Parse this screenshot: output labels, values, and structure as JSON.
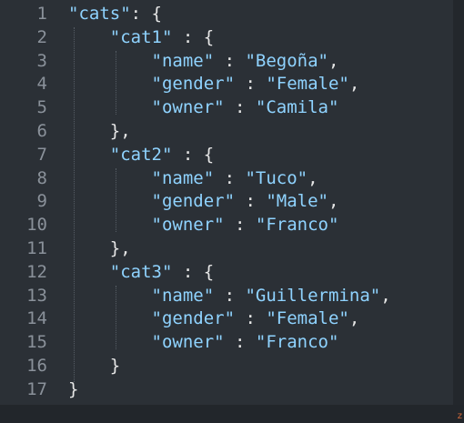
{
  "colors": {
    "background": "#2b3036",
    "line_number": "#8a919a",
    "string": "#8fd3ff",
    "punctuation": "#e6e6e6"
  },
  "lines": [
    {
      "num": "1",
      "indent": "",
      "tokens": [
        {
          "t": "s",
          "v": "\"cats\""
        },
        {
          "t": "p",
          "v": ": {"
        }
      ]
    },
    {
      "num": "2",
      "indent": "    ",
      "tokens": [
        {
          "t": "s",
          "v": "\"cat1\""
        },
        {
          "t": "p",
          "v": " : {"
        }
      ]
    },
    {
      "num": "3",
      "indent": "        ",
      "tokens": [
        {
          "t": "s",
          "v": "\"name\""
        },
        {
          "t": "p",
          "v": " : "
        },
        {
          "t": "v",
          "v": "\"Begoña\""
        },
        {
          "t": "p",
          "v": ","
        }
      ]
    },
    {
      "num": "4",
      "indent": "        ",
      "tokens": [
        {
          "t": "s",
          "v": "\"gender\""
        },
        {
          "t": "p",
          "v": " : "
        },
        {
          "t": "v",
          "v": "\"Female\""
        },
        {
          "t": "p",
          "v": ","
        }
      ]
    },
    {
      "num": "5",
      "indent": "        ",
      "tokens": [
        {
          "t": "s",
          "v": "\"owner\""
        },
        {
          "t": "p",
          "v": " : "
        },
        {
          "t": "v",
          "v": "\"Camila\""
        }
      ]
    },
    {
      "num": "6",
      "indent": "    ",
      "tokens": [
        {
          "t": "p",
          "v": "},"
        }
      ]
    },
    {
      "num": "7",
      "indent": "    ",
      "tokens": [
        {
          "t": "s",
          "v": "\"cat2\""
        },
        {
          "t": "p",
          "v": " : {"
        }
      ]
    },
    {
      "num": "8",
      "indent": "        ",
      "tokens": [
        {
          "t": "s",
          "v": "\"name\""
        },
        {
          "t": "p",
          "v": " : "
        },
        {
          "t": "v",
          "v": "\"Tuco\""
        },
        {
          "t": "p",
          "v": ","
        }
      ]
    },
    {
      "num": "9",
      "indent": "        ",
      "tokens": [
        {
          "t": "s",
          "v": "\"gender\""
        },
        {
          "t": "p",
          "v": " : "
        },
        {
          "t": "v",
          "v": "\"Male\""
        },
        {
          "t": "p",
          "v": ","
        }
      ]
    },
    {
      "num": "10",
      "indent": "        ",
      "tokens": [
        {
          "t": "s",
          "v": "\"owner\""
        },
        {
          "t": "p",
          "v": " : "
        },
        {
          "t": "v",
          "v": "\"Franco\""
        }
      ]
    },
    {
      "num": "11",
      "indent": "    ",
      "tokens": [
        {
          "t": "p",
          "v": "},"
        }
      ]
    },
    {
      "num": "12",
      "indent": "    ",
      "tokens": [
        {
          "t": "s",
          "v": "\"cat3\""
        },
        {
          "t": "p",
          "v": " : {"
        }
      ]
    },
    {
      "num": "13",
      "indent": "        ",
      "tokens": [
        {
          "t": "s",
          "v": "\"name\""
        },
        {
          "t": "p",
          "v": " : "
        },
        {
          "t": "v",
          "v": "\"Guillermina\""
        },
        {
          "t": "p",
          "v": ","
        }
      ]
    },
    {
      "num": "14",
      "indent": "        ",
      "tokens": [
        {
          "t": "s",
          "v": "\"gender\""
        },
        {
          "t": "p",
          "v": " : "
        },
        {
          "t": "v",
          "v": "\"Female\""
        },
        {
          "t": "p",
          "v": ","
        }
      ]
    },
    {
      "num": "15",
      "indent": "        ",
      "tokens": [
        {
          "t": "s",
          "v": "\"owner\""
        },
        {
          "t": "p",
          "v": " : "
        },
        {
          "t": "v",
          "v": "\"Franco\""
        }
      ]
    },
    {
      "num": "16",
      "indent": "    ",
      "tokens": [
        {
          "t": "p",
          "v": "}"
        }
      ]
    },
    {
      "num": "17",
      "indent": "",
      "tokens": [
        {
          "t": "p",
          "v": "}"
        }
      ]
    }
  ],
  "corner_mark": "z"
}
